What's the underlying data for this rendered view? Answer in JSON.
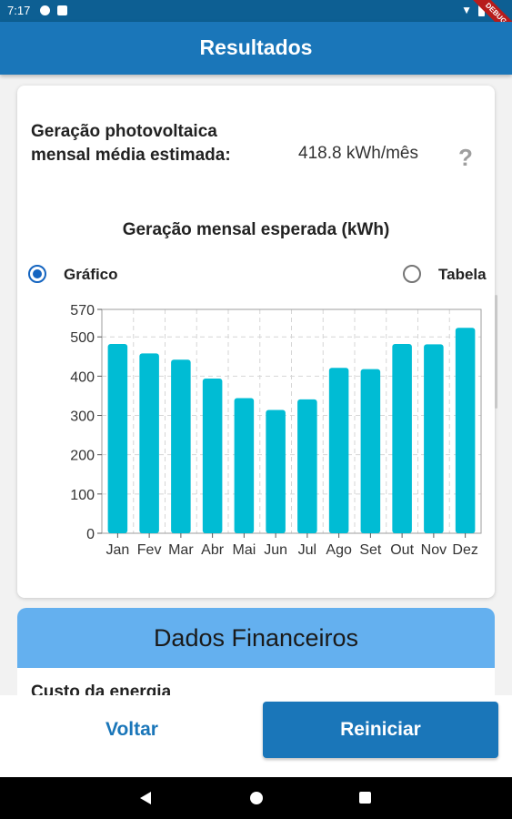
{
  "status_bar": {
    "time": "7:17",
    "debug_ribbon": "DEBUG"
  },
  "app_bar": {
    "title": "Resultados"
  },
  "summary": {
    "generation_label": "Geração photovoltaica mensal média estimada:",
    "generation_value": "418.8 kWh/mês",
    "help_icon": "?"
  },
  "chart_section": {
    "title": "Geração mensal esperada (kWh)",
    "view_options": [
      {
        "label": "Gráfico",
        "selected": true
      },
      {
        "label": "Tabela",
        "selected": false
      }
    ]
  },
  "chart_data": {
    "type": "bar",
    "title": "Geração mensal esperada (kWh)",
    "categories": [
      "Jan",
      "Fev",
      "Mar",
      "Abr",
      "Mai",
      "Jun",
      "Jul",
      "Ago",
      "Set",
      "Out",
      "Nov",
      "Dez"
    ],
    "values": [
      482,
      458,
      442,
      394,
      344,
      314,
      341,
      421,
      418,
      482,
      481,
      523
    ],
    "ylim": [
      0,
      570
    ],
    "yticks": [
      0,
      100,
      200,
      300,
      400,
      500,
      570
    ],
    "grid": true,
    "colors": {
      "bar": "#00bcd4"
    }
  },
  "financial": {
    "header": "Dados Financeiros",
    "first_row_label": "Custo da energia"
  },
  "buttons": {
    "back": "Voltar",
    "restart": "Reiniciar"
  },
  "colors": {
    "primary": "#1a76b9",
    "status_bar": "#0d5f93",
    "financial_header": "#64b0ef"
  }
}
